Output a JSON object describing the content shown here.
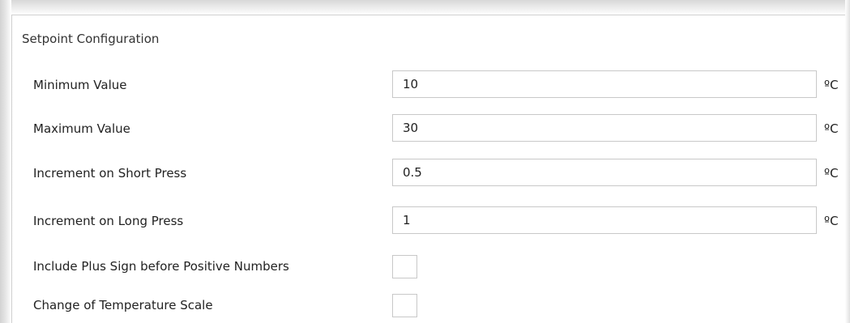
{
  "section": {
    "title": "Setpoint Configuration"
  },
  "fields": [
    {
      "label": "Minimum Value",
      "value": "10",
      "unit": "ºC"
    },
    {
      "label": "Maximum Value",
      "value": "30",
      "unit": "ºC"
    },
    {
      "label": "Increment on Short Press",
      "value": "0.5",
      "unit": "ºC"
    },
    {
      "label": "Increment on Long Press",
      "value": "1",
      "unit": "ºC"
    }
  ],
  "checkboxes": [
    {
      "label": "Include Plus Sign before Positive Numbers",
      "checked": false
    },
    {
      "label": "Change of Temperature Scale",
      "checked": false
    }
  ],
  "colors": {
    "border": "#c8c8c8",
    "text": "#222222",
    "background": "#ffffff"
  }
}
